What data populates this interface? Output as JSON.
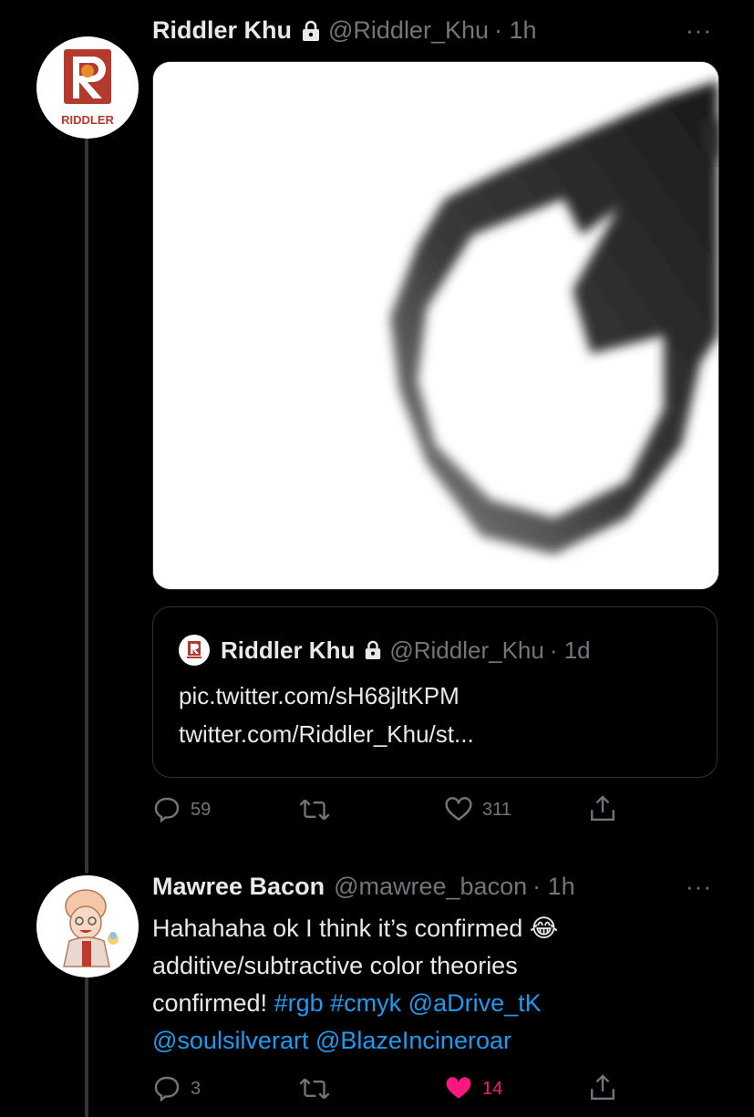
{
  "tweet1": {
    "name": "Riddler Khu",
    "handle": "@Riddler_Khu",
    "time": "· 1h",
    "avatar_text": "RIDDLER",
    "quote": {
      "name": "Riddler Khu",
      "handle": "@Riddler_Khu",
      "time": "· 1d",
      "line1": "pic.twitter.com/sH68jltKPM",
      "line2": "twitter.com/Riddler_Khu/st..."
    },
    "replies": "59",
    "retweets": "",
    "likes": "311"
  },
  "tweet2": {
    "name": "Mawree Bacon",
    "handle": "@mawree_bacon",
    "time": "· 1h",
    "text_line1": "Hahahaha ok I think it’s confirmed ",
    "emoji": "😂",
    "text_line2": "additive/subtractive color theories",
    "text_line3_plain": "confirmed! ",
    "tag1": "#rgb",
    "tag2": "#cmyk",
    "mention1": "@aDrive_tK",
    "mention2": "@soulsilverart",
    "mention3": "@BlazeIncineroar",
    "replies": "3",
    "likes": "14"
  },
  "more_label": "···",
  "colors": {
    "like_active": "#f91880",
    "link": "#1d9bf0",
    "muted": "#71767b",
    "brand_red": "#b33a2c"
  }
}
